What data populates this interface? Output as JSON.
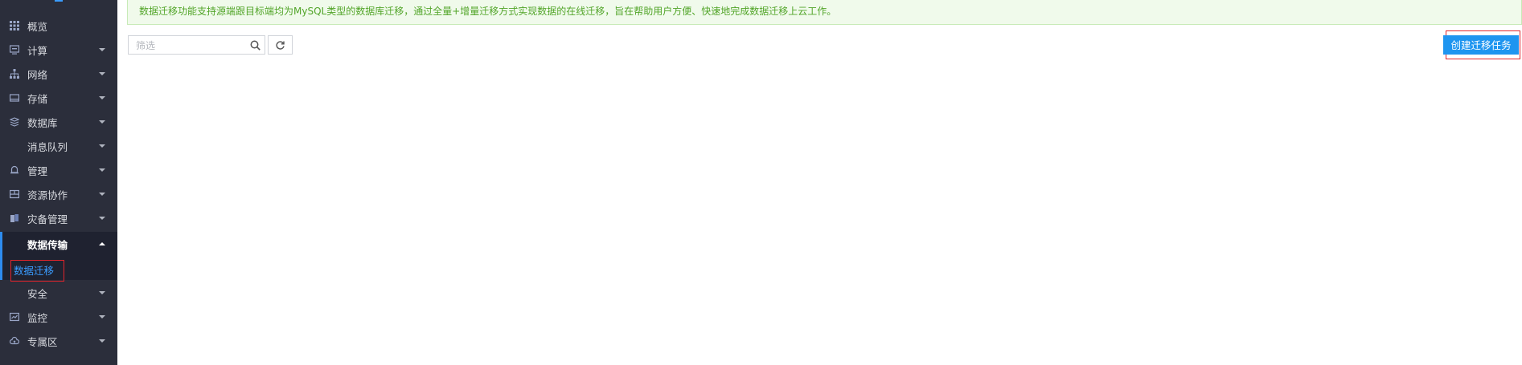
{
  "sidebar": {
    "items": [
      {
        "label": "概览",
        "icon": "grid-icon"
      },
      {
        "label": "计算",
        "icon": "monitor-icon"
      },
      {
        "label": "网络",
        "icon": "network-icon"
      },
      {
        "label": "存储",
        "icon": "storage-icon"
      },
      {
        "label": "数据库",
        "icon": "layers-icon"
      },
      {
        "label": "消息队列",
        "icon": ""
      },
      {
        "label": "管理",
        "icon": "bell-icon"
      },
      {
        "label": "资源协作",
        "icon": "collab-icon"
      },
      {
        "label": "灾备管理",
        "icon": "backup-icon"
      },
      {
        "label": "数据传输",
        "icon": ""
      },
      {
        "label": "数据迁移",
        "icon": ""
      },
      {
        "label": "安全",
        "icon": ""
      },
      {
        "label": "监控",
        "icon": "chart-icon"
      },
      {
        "label": "专属区",
        "icon": "cloud-icon"
      }
    ]
  },
  "banner": {
    "text": "数据迁移功能支持源端跟目标端均为MySQL类型的数据库迁移，通过全量+增量迁移方式实现数据的在线迁移，旨在帮助用户方便、快速地完成数据迁移上云工作。"
  },
  "toolbar": {
    "filter_placeholder": "筛选",
    "create_label": "创建迁移任务"
  },
  "colors": {
    "sidebar_bg": "#2b2e3b",
    "accent": "#1e95f0",
    "banner_text": "#52a529",
    "highlight_border": "#e0242b"
  }
}
